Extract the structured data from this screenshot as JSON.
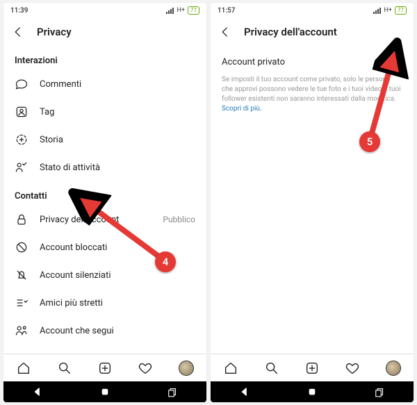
{
  "left": {
    "status_time": "11:39",
    "status_net": "H+",
    "status_batt": "77",
    "header_title": "Privacy",
    "sec1_label": "Interazioni",
    "sec1_items": [
      {
        "icon": "comment",
        "label": "Commenti"
      },
      {
        "icon": "tag",
        "label": "Tag"
      },
      {
        "icon": "story",
        "label": "Storia"
      },
      {
        "icon": "activity",
        "label": "Stato di attività"
      }
    ],
    "sec2_label": "Contatti",
    "sec2_items": [
      {
        "icon": "lock",
        "label": "Privacy dell'account",
        "trail": "Pubblico"
      },
      {
        "icon": "blocked",
        "label": "Account bloccati"
      },
      {
        "icon": "muted",
        "label": "Account silenziati"
      },
      {
        "icon": "close-friends",
        "label": "Amici più stretti"
      },
      {
        "icon": "following",
        "label": "Account che segui"
      }
    ]
  },
  "right": {
    "status_time": "11:57",
    "status_net": "H+",
    "status_batt": "77",
    "header_title": "Privacy dell'account",
    "toggle_label": "Account privato",
    "desc_text": "Se imposti il tuo account come privato, solo le persone che approvi possono vedere le tue foto e i tuoi video. I tuoi follower esistenti non saranno interessati dalla modifica.",
    "desc_link": "Scopri di più."
  },
  "annotations": {
    "step4": "4",
    "step5": "5"
  }
}
